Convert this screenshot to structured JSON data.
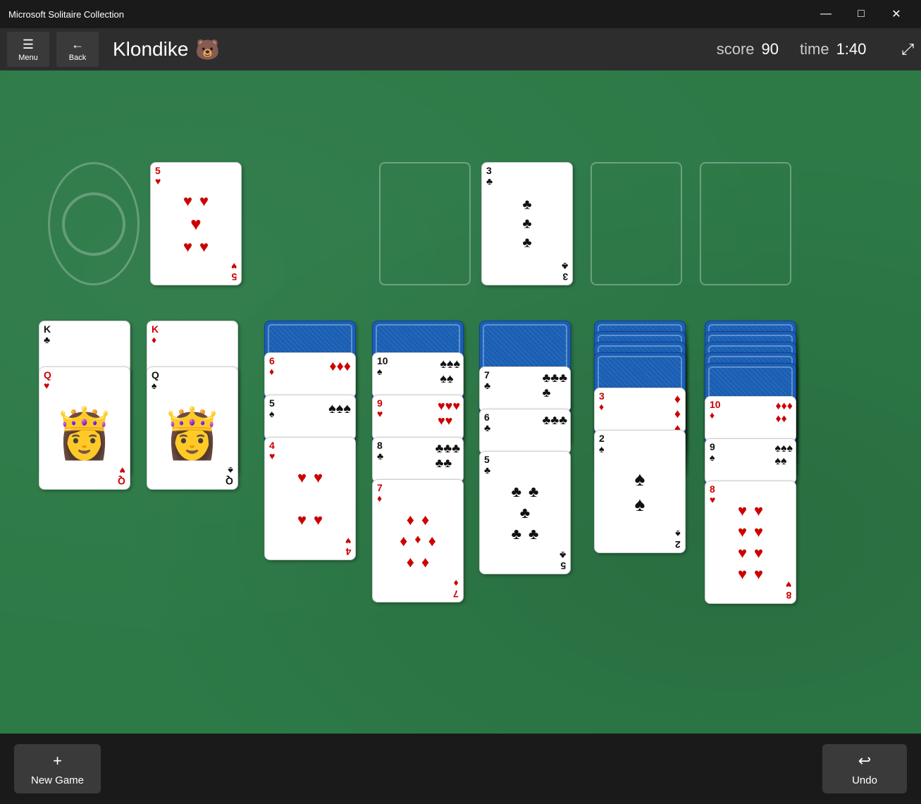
{
  "app": {
    "title": "Microsoft Solitaire Collection",
    "min_label": "—",
    "max_label": "□",
    "close_label": "✕"
  },
  "nav": {
    "menu_label": "Menu",
    "back_label": "Back",
    "game_name": "Klondike",
    "score_label": "score",
    "score_value": "90",
    "time_label": "time",
    "time_value": "1:40"
  },
  "bottom_bar": {
    "new_game_label": "New Game",
    "new_game_icon": "+",
    "undo_label": "Undo",
    "undo_icon": "↩"
  },
  "colors": {
    "green_felt": "#2d7a47",
    "card_back_blue": "#1a5fb4",
    "red": "#cc0000",
    "black": "#111111"
  }
}
